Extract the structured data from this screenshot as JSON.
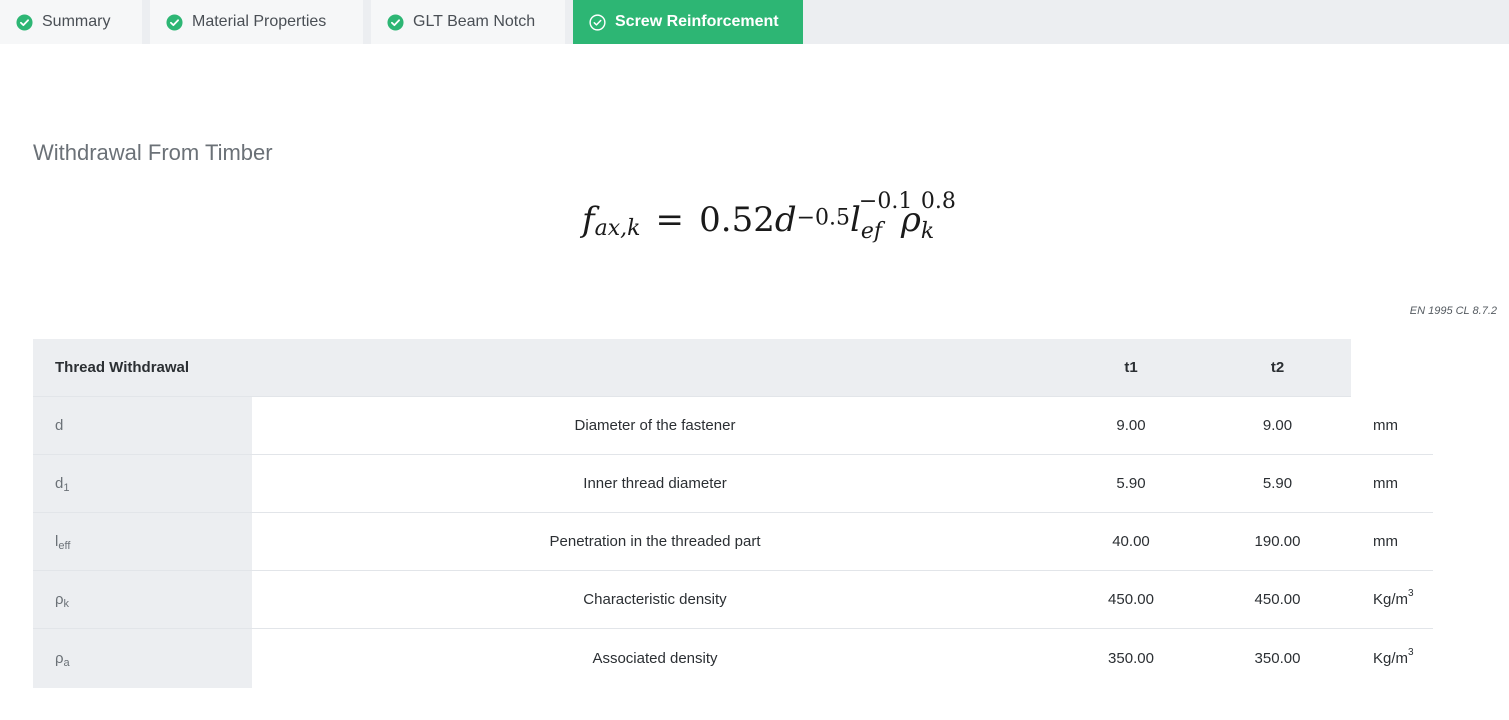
{
  "tabs": [
    {
      "label": "Summary",
      "icon": "check-circle-icon",
      "active": false
    },
    {
      "label": "Material Properties",
      "icon": "check-circle-icon",
      "active": false
    },
    {
      "label": "GLT Beam Notch",
      "icon": "check-circle-icon",
      "active": false
    },
    {
      "label": "Screw Reinforcement",
      "icon": "check-circle-outline-icon",
      "active": true
    }
  ],
  "colors": {
    "accent": "#2db674",
    "tab_bg": "#eceef1",
    "header_bg": "#eceef1"
  },
  "section": {
    "title": "Withdrawal From Timber",
    "formula": {
      "lhs": "f",
      "lhs_sub": "ax,k",
      "equals": "=",
      "coef": "0.52",
      "d": "d",
      "d_exp": "−0.5",
      "l": "l",
      "l_sub": "ef",
      "l_exp": "−0.1",
      "rho": "ρ",
      "rho_sub": "k",
      "rho_exp": "0.8"
    },
    "reference": "EN 1995 CL 8.7.2"
  },
  "table": {
    "header": {
      "title": "Thread Withdrawal",
      "t1": "t1",
      "t2": "t2"
    },
    "rows": [
      {
        "sym": "d",
        "sym_sub": "",
        "desc": "Diameter of the fastener",
        "t1": "9.00",
        "t2": "9.00",
        "unit": "mm",
        "unit_sup": ""
      },
      {
        "sym": "d",
        "sym_sub": "1",
        "desc": "Inner thread diameter",
        "t1": "5.90",
        "t2": "5.90",
        "unit": "mm",
        "unit_sup": ""
      },
      {
        "sym": "l",
        "sym_sub": "eff",
        "desc": "Penetration in the threaded part",
        "t1": "40.00",
        "t2": "190.00",
        "unit": "mm",
        "unit_sup": ""
      },
      {
        "sym": "ρ",
        "sym_sub": "k",
        "desc": "Characteristic density",
        "t1": "450.00",
        "t2": "450.00",
        "unit": "Kg/m",
        "unit_sup": "3"
      },
      {
        "sym": "ρ",
        "sym_sub": "a",
        "desc": "Associated density",
        "t1": "350.00",
        "t2": "350.00",
        "unit": "Kg/m",
        "unit_sup": "3"
      }
    ]
  }
}
